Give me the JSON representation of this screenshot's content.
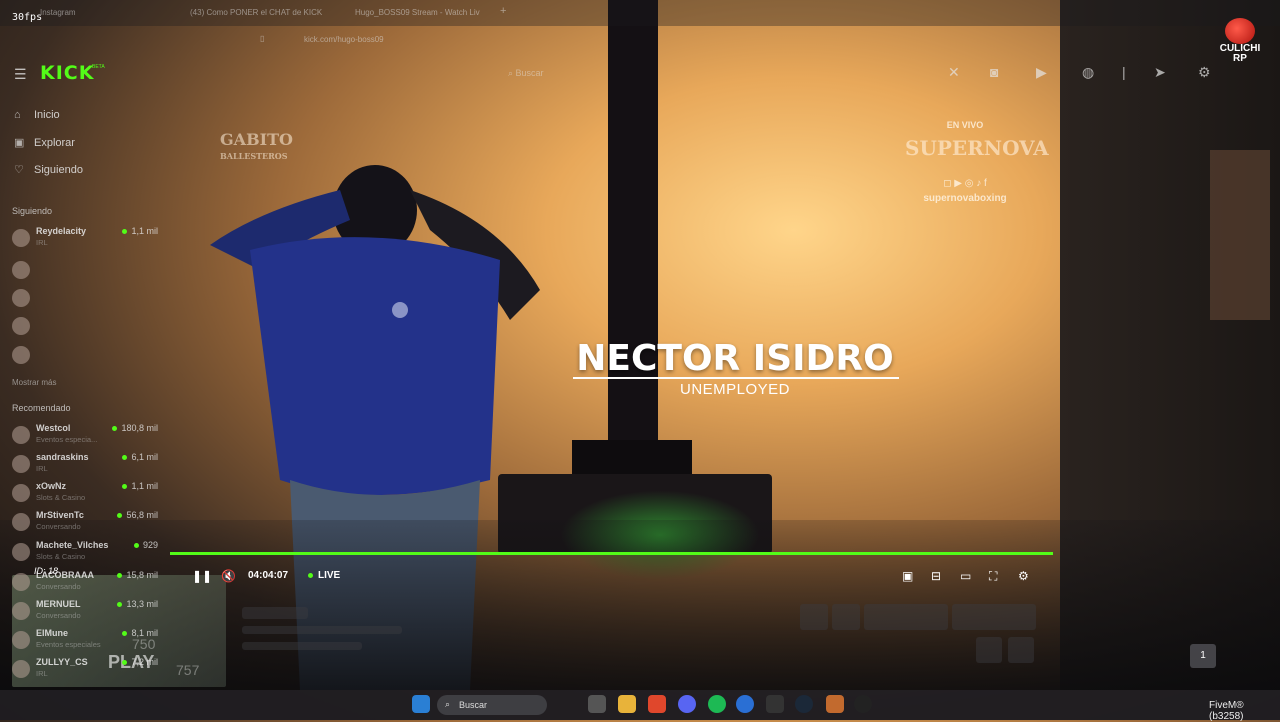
{
  "overlay": {
    "fps": "30fps"
  },
  "browser": {
    "tabs": [
      "Instagram",
      "(43) Como PONER el CHAT de KICK",
      "Hugo_BOSS09 Stream - Watch Liv"
    ],
    "new_tab": "+",
    "url": "kick.com/hugo-boss09"
  },
  "kick": {
    "logo": "KICK",
    "beta": "BETA",
    "search_placeholder": "Buscar",
    "nav": [
      {
        "icon": "home-icon",
        "label": "Inicio"
      },
      {
        "icon": "compass-icon",
        "label": "Explorar"
      },
      {
        "icon": "heart-icon",
        "label": "Siguiendo"
      }
    ],
    "following_title": "Siguiendo",
    "following": [
      {
        "name": "Reydelacity",
        "sub": "IRL",
        "viewers": "1,1 mil"
      }
    ],
    "show_more": "Mostrar más",
    "recommended_title": "Recomendado",
    "recommended": [
      {
        "name": "Westcol",
        "sub": "Eventos especia...",
        "viewers": "180,8 mil"
      },
      {
        "name": "sandraskins",
        "sub": "IRL",
        "viewers": "6,1 mil"
      },
      {
        "name": "xOwNz",
        "sub": "Slots & Casino",
        "viewers": "1,1 mil"
      },
      {
        "name": "MrStivenTc",
        "sub": "Conversando",
        "viewers": "56,8 mil"
      },
      {
        "name": "Machete_Vilches",
        "sub": "Slots & Casino",
        "viewers": "929"
      },
      {
        "name": "LACOBRAAA",
        "sub": "Conversando",
        "viewers": "15,8 mil"
      },
      {
        "name": "MERNUEL",
        "sub": "Conversando",
        "viewers": "13,3 mil"
      },
      {
        "name": "ElMune",
        "sub": "Eventos especiales",
        "viewers": "8,1 mil"
      },
      {
        "name": "ZULLYY_CS",
        "sub": "IRL",
        "viewers": "7,2 mil"
      }
    ]
  },
  "stream": {
    "gabito_logo": "GABITO",
    "gabito_sub": "BALLESTEROS",
    "en_vivo": "EN VIVO",
    "supernova": "SUPERNOVA",
    "supernova_social": "◻ ▶ ◎ ♪ f",
    "supernova_handle": "supernovaboxing",
    "culichi": "CULICHI",
    "culichi_rp": "RP",
    "player_name": "NECTOR ISIDRO",
    "player_job": "UNEMPLOYED",
    "minimap_id": "ID: 18",
    "minimap_play": "PLAY",
    "minimap_n1": "750",
    "minimap_n2": "757"
  },
  "player": {
    "time": "04:04:07",
    "live": "LIVE",
    "progress": 1.0,
    "page": "1"
  },
  "taskbar": {
    "search": "Buscar",
    "fivem": "FiveM® (b3258)"
  }
}
